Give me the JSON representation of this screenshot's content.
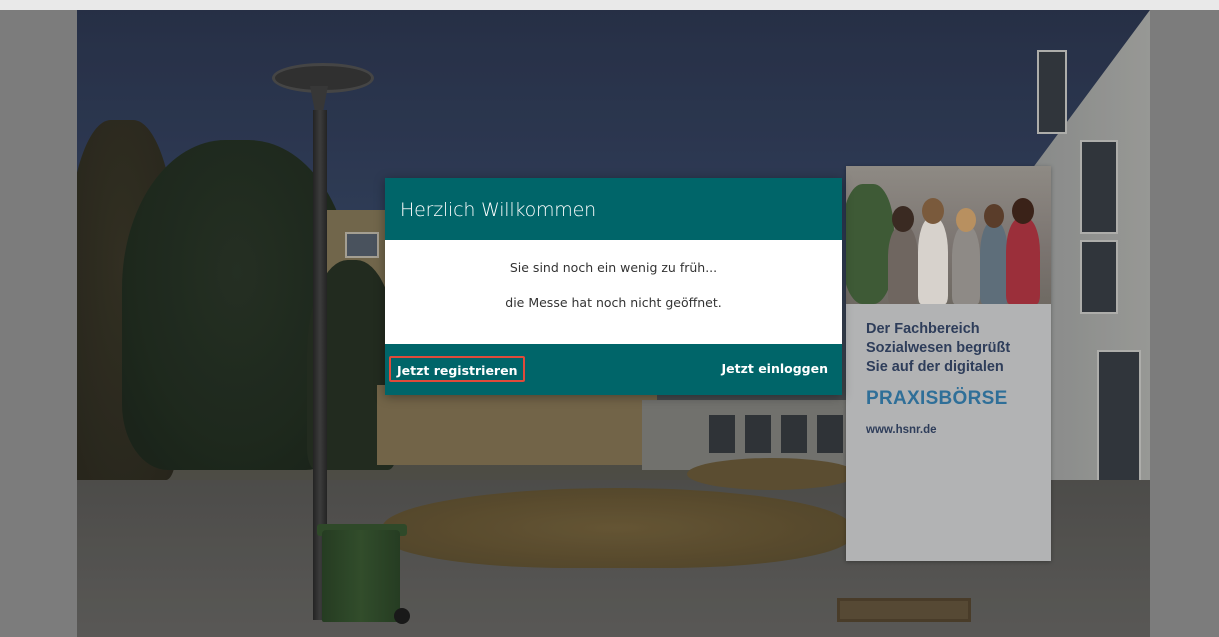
{
  "modal": {
    "title": "Herzlich Willkommen",
    "message_line1": "Sie sind noch ein wenig zu früh...",
    "message_line2": "die Messe hat noch nicht geöffnet.",
    "register_label": "Jetzt registrieren",
    "login_label": "Jetzt einloggen"
  },
  "poster": {
    "text_lines": [
      "Der Fachbereich",
      "Sozialwesen begrüßt",
      "Sie auf der digitalen"
    ],
    "title": "PRAXISBÖRSE",
    "url": "www.hsnr.de"
  },
  "colors": {
    "modal_teal": "#006569",
    "register_highlight": "#e04a3a",
    "poster_title_blue": "#2f6f98",
    "poster_text_navy": "#2e3d5a"
  }
}
